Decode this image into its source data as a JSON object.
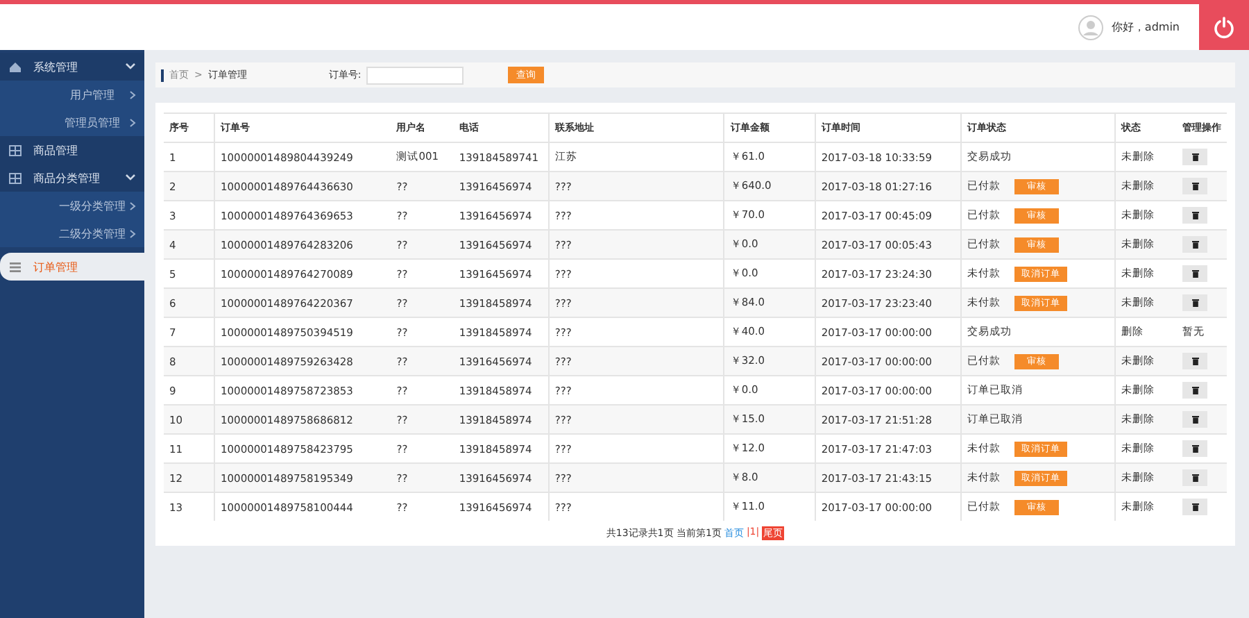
{
  "header": {
    "greeting": "你好，admin"
  },
  "sidebar": {
    "items": [
      {
        "label": "系统管理",
        "kind": "home",
        "expanded": true,
        "selected": false,
        "children": [
          {
            "label": "用户管理",
            "selected": false
          },
          {
            "label": "管理员管理",
            "selected": false
          }
        ]
      },
      {
        "label": "商品管理",
        "kind": "grid",
        "selected": false
      },
      {
        "label": "商品分类管理",
        "kind": "grid",
        "expanded": true,
        "selected": false,
        "children": [
          {
            "label": "一级分类管理",
            "selected": false
          },
          {
            "label": "二级分类管理",
            "selected": false
          }
        ]
      },
      {
        "label": "订单管理",
        "kind": "list",
        "selected": true
      }
    ]
  },
  "breadcrumb": [
    "首页",
    ">",
    "订单管理"
  ],
  "search": {
    "label": "订单号:",
    "button": "查询"
  },
  "table": {
    "columns": [
      "序号",
      "订单号",
      "用户名",
      "电话",
      "联系地址",
      "订单金额",
      "订单时间",
      "订单状态",
      "状态",
      "管理操作"
    ],
    "rows": [
      {
        "cells": [
          "1",
          "10000001489804439249",
          "测试001",
          "139184589741",
          "江苏",
          "￥61.0",
          "2017-03-18 10:33:59",
          "交易成功",
          "未删除"
        ],
        "action": null,
        "op": {
          "kind": "delete"
        }
      },
      {
        "cells": [
          "2",
          "10000001489764436630",
          "??",
          "13916456974",
          "???",
          "￥640.0",
          "2017-03-18 01:27:16",
          "已付款",
          "未删除"
        ],
        "action": "审核",
        "op": {
          "kind": "delete"
        }
      },
      {
        "cells": [
          "3",
          "10000001489764369653",
          "??",
          "13916456974",
          "???",
          "￥70.0",
          "2017-03-17 00:45:09",
          "已付款",
          "未删除"
        ],
        "action": "审核",
        "op": {
          "kind": "delete"
        }
      },
      {
        "cells": [
          "4",
          "10000001489764283206",
          "??",
          "13916456974",
          "???",
          "￥0.0",
          "2017-03-17 00:05:43",
          "已付款",
          "未删除"
        ],
        "action": "审核",
        "op": {
          "kind": "delete"
        }
      },
      {
        "cells": [
          "5",
          "10000001489764270089",
          "??",
          "13916456974",
          "???",
          "￥0.0",
          "2017-03-17 23:24:30",
          "未付款",
          "未删除"
        ],
        "action": "取消订单",
        "op": {
          "kind": "delete"
        }
      },
      {
        "cells": [
          "6",
          "10000001489764220367",
          "??",
          "13918458974",
          "???",
          "￥84.0",
          "2017-03-17 23:23:40",
          "未付款",
          "未删除"
        ],
        "action": "取消订单",
        "op": {
          "kind": "delete"
        }
      },
      {
        "cells": [
          "7",
          "10000001489750394519",
          "??",
          "13918458974",
          "???",
          "￥40.0",
          "2017-03-17 00:00:00",
          "交易成功",
          "删除"
        ],
        "action": null,
        "op": {
          "kind": "text",
          "label": "暂无"
        }
      },
      {
        "cells": [
          "8",
          "10000001489759263428",
          "??",
          "13916456974",
          "???",
          "￥32.0",
          "2017-03-17 00:00:00",
          "已付款",
          "未删除"
        ],
        "action": "审核",
        "op": {
          "kind": "delete"
        }
      },
      {
        "cells": [
          "9",
          "10000001489758723853",
          "??",
          "13918458974",
          "???",
          "￥0.0",
          "2017-03-17 00:00:00",
          "订单已取消",
          "未删除"
        ],
        "action": null,
        "op": {
          "kind": "delete"
        }
      },
      {
        "cells": [
          "10",
          "10000001489758686812",
          "??",
          "13918458974",
          "???",
          "￥15.0",
          "2017-03-17 21:51:28",
          "订单已取消",
          "未删除"
        ],
        "action": null,
        "op": {
          "kind": "delete"
        }
      },
      {
        "cells": [
          "11",
          "10000001489758423795",
          "??",
          "13918458974",
          "???",
          "￥12.0",
          "2017-03-17 21:47:03",
          "未付款",
          "未删除"
        ],
        "action": "取消订单",
        "op": {
          "kind": "delete"
        }
      },
      {
        "cells": [
          "12",
          "10000001489758195349",
          "??",
          "13916456974",
          "???",
          "￥8.0",
          "2017-03-17 21:43:15",
          "未付款",
          "未删除"
        ],
        "action": "取消订单",
        "op": {
          "kind": "delete"
        }
      },
      {
        "cells": [
          "13",
          "10000001489758100444",
          "??",
          "13916456974",
          "???",
          "￥11.0",
          "2017-03-17 00:00:00",
          "已付款",
          "未删除"
        ],
        "action": "审核",
        "op": {
          "kind": "delete"
        }
      }
    ]
  },
  "pagination": {
    "summary": "共13记录共1页 当前第1页",
    "first": "首页",
    "current": "|1|",
    "last": "尾页"
  }
}
